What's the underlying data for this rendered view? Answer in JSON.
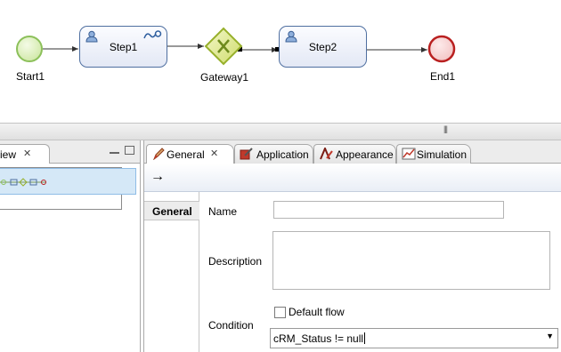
{
  "diagram": {
    "start_label": "Start1",
    "step1_label": "Step1",
    "gateway_label": "Gateway1",
    "step2_label": "Step2",
    "end_label": "End1"
  },
  "left_view": {
    "tab_label": "iew",
    "close_glyph": "✕"
  },
  "properties": {
    "tabs": [
      {
        "label": "General",
        "icon": "pencil-icon"
      },
      {
        "label": "Application",
        "icon": "application-icon"
      },
      {
        "label": "Appearance",
        "icon": "appearance-icon"
      },
      {
        "label": "Simulation",
        "icon": "simulation-icon"
      }
    ],
    "tab_close_glyph": "✕",
    "toolbar_arrow": "→",
    "section": "General",
    "name_label": "Name",
    "name_value": "",
    "description_label": "Description",
    "description_value": "",
    "default_flow_label": "Default flow",
    "default_flow_checked": false,
    "condition_label": "Condition",
    "condition_value": "cRM_Status != null"
  },
  "colors": {
    "start_event": "#a6d264",
    "end_event": "#b92020",
    "gateway": "#c9d86a",
    "task_border": "#4f6fa0"
  }
}
